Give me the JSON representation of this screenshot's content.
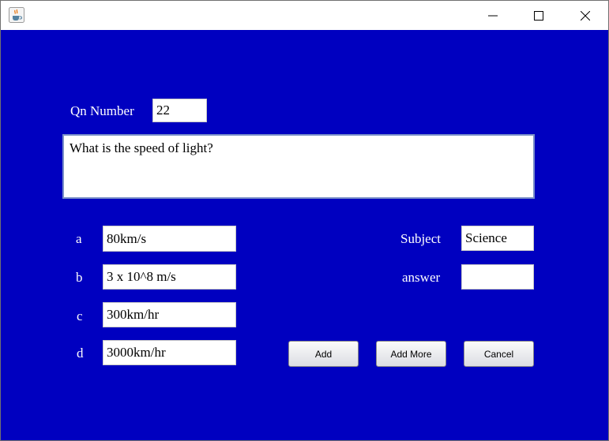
{
  "window": {
    "icon": "java-coffee-cup-icon",
    "controls": [
      "minimize-icon",
      "maximize-icon",
      "close-icon"
    ]
  },
  "form": {
    "qn_label": "Qn Number",
    "qn_value": "22",
    "question": "What is the speed of light?",
    "options": [
      {
        "label": "a",
        "value": "80km/s"
      },
      {
        "label": "b",
        "value": "3 x 10^8 m/s"
      },
      {
        "label": "c",
        "value": "300km/hr"
      },
      {
        "label": "d",
        "value": "3000km/hr"
      }
    ],
    "subject_label": "Subject",
    "subject_value": "Science",
    "answer_label": "answer",
    "answer_value": ""
  },
  "buttons": {
    "add": "Add",
    "add_more": "Add More",
    "cancel": "Cancel"
  },
  "colors": {
    "background": "#0000c0",
    "label_text": "#ffffff"
  }
}
